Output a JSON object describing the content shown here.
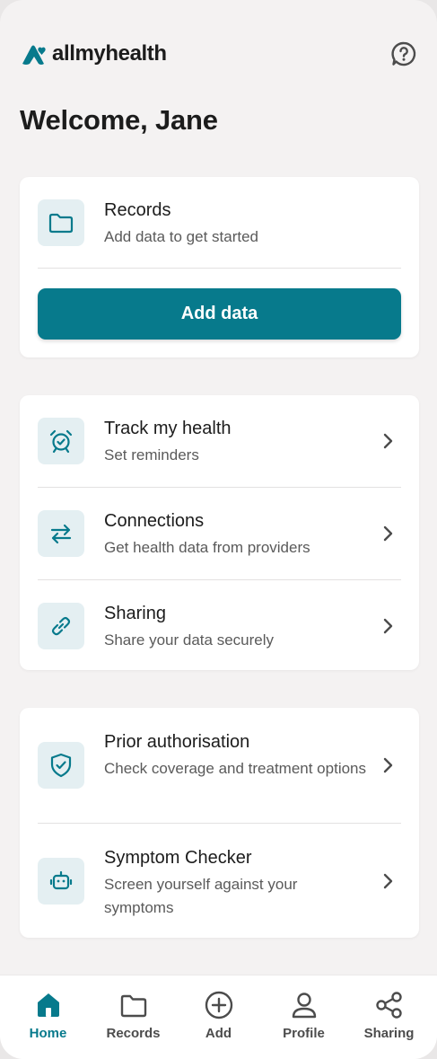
{
  "app": {
    "brand": "allmyhealth"
  },
  "colors": {
    "accent": "#077a8c",
    "icon_bg": "#e4eff2"
  },
  "header": {
    "help_icon": "help-bubble-icon"
  },
  "welcome": "Welcome, Jane",
  "records_card": {
    "title": "Records",
    "subtitle": "Add data to get started",
    "icon": "folder-icon",
    "button_label": "Add data"
  },
  "menu_group_1": [
    {
      "title": "Track my health",
      "subtitle": "Set reminders",
      "icon": "alarm-clock-icon"
    },
    {
      "title": "Connections",
      "subtitle": "Get health data from providers",
      "icon": "arrows-swap-icon"
    },
    {
      "title": "Sharing",
      "subtitle": "Share your data securely",
      "icon": "link-icon"
    }
  ],
  "menu_group_2": [
    {
      "title": "Prior authorisation",
      "subtitle": "Check coverage and treatment options",
      "icon": "shield-check-icon"
    },
    {
      "title": "Symptom Checker",
      "subtitle": "Screen yourself against your symptoms",
      "icon": "robot-icon"
    }
  ],
  "bottom_nav": [
    {
      "label": "Home",
      "icon": "home-icon",
      "active": true
    },
    {
      "label": "Records",
      "icon": "folder-icon",
      "active": false
    },
    {
      "label": "Add",
      "icon": "plus-circle-icon",
      "active": false
    },
    {
      "label": "Profile",
      "icon": "user-icon",
      "active": false
    },
    {
      "label": "Sharing",
      "icon": "share-icon",
      "active": false
    }
  ]
}
